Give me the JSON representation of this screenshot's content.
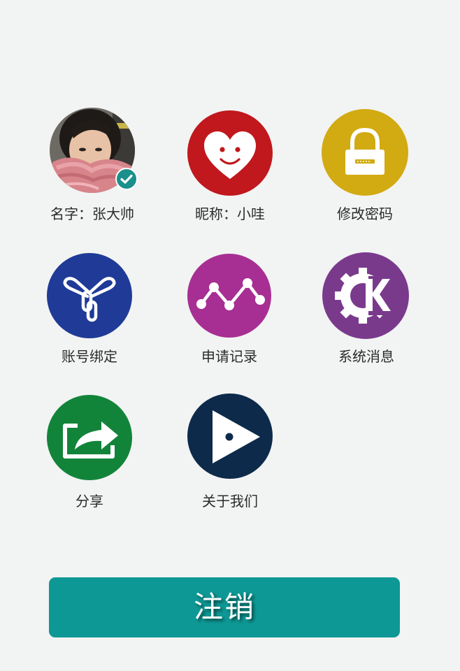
{
  "profile": {
    "name_label": "名字：张大帅",
    "nickname_label": "昵称：小哇"
  },
  "menu": {
    "change_password": "修改密码",
    "account_binding": "账号绑定",
    "application_records": "申请记录",
    "system_messages": "系统消息",
    "share": "分享",
    "about_us": "关于我们"
  },
  "logout_label": "注销",
  "colors": {
    "background": "#f2f3f3",
    "nickname_red": "#c0181c",
    "password_gold": "#d2aa12",
    "binding_blue": "#1f3b97",
    "records_magenta": "#a72f93",
    "messages_purple": "#7a3a8c",
    "share_green": "#12843a",
    "about_navy": "#0d2a4a",
    "logout_teal": "#0e9895",
    "verified_teal": "#1a8f8c"
  },
  "icons": {
    "avatar": "user-avatar-photo",
    "verified": "check-badge-icon",
    "nickname": "heart-face-icon",
    "password": "lock-icon",
    "binding": "link-icon",
    "records": "line-chart-icon",
    "messages": "kde-gear-icon",
    "share": "share-icon",
    "about": "play-icon"
  }
}
